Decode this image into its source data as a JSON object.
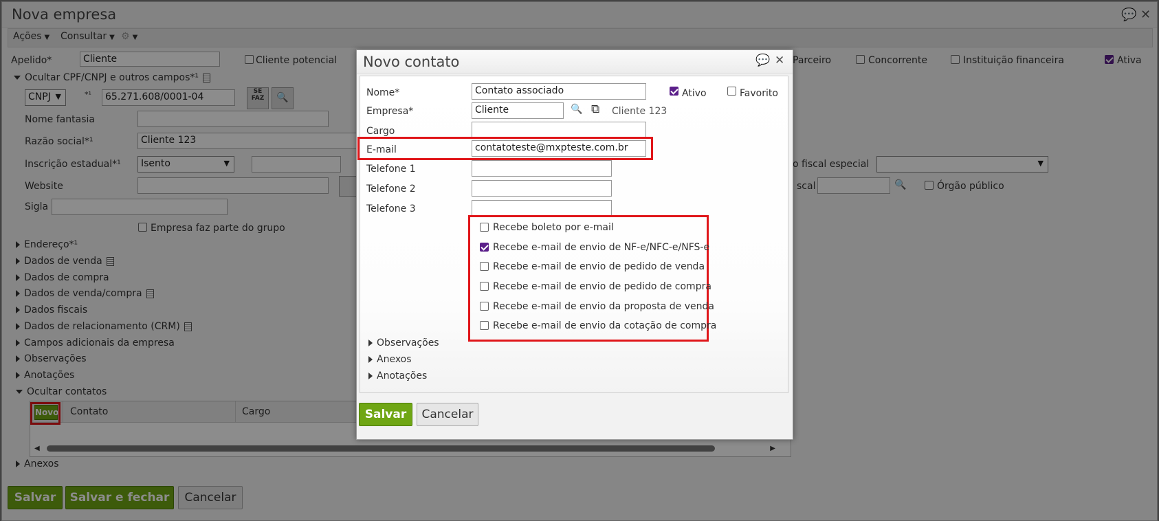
{
  "background": {
    "title": "Nova empresa",
    "toolbar": {
      "acoes": "Ações",
      "consultar": "Consultar"
    },
    "apelido_label": "Apelido*",
    "apelido_value": "Cliente",
    "cliente_potencial": "Cliente potencial",
    "parceiro": "Parceiro",
    "concorrente": "Concorrente",
    "instituicao_financeira": "Instituição financeira",
    "ativa": "Ativa",
    "ocultar_cpf": "Ocultar CPF/CNPJ e outros campos*¹",
    "doc_type": "CNPJ",
    "doc_superscript": "*¹",
    "cnpj_value": "65.271.608/0001-04",
    "nome_fantasia": "Nome fantasia",
    "razao_social": "Razão social*¹",
    "razao_social_value": "Cliente 123",
    "inscricao_estadual": "Inscrição estadual*¹",
    "inscricao_value": "Isento",
    "website": "Website",
    "sigla": "Sigla",
    "empresa_grupo": "Empresa faz parte do grupo",
    "regime_especial": "o fiscal especial",
    "fiscal": "scal",
    "orgao_publico": "Órgão público",
    "sections": [
      "Endereço*¹",
      "Dados de venda",
      "Dados de compra",
      "Dados de venda/compra",
      "Dados fiscais",
      "Dados de relacionamento (CRM)",
      "Campos adicionais da empresa",
      "Observações",
      "Anotações"
    ],
    "ocultar_contatos": "Ocultar contatos",
    "grid": {
      "novo": "Novo",
      "contato": "Contato",
      "cargo": "Cargo"
    },
    "anexos": "Anexos",
    "buttons": {
      "salvar": "Salvar",
      "salvar_fechar": "Salvar e fechar",
      "cancelar": "Cancelar"
    }
  },
  "modal": {
    "title": "Novo contato",
    "nome_label": "Nome*",
    "nome_value": "Contato associado",
    "ativo": "Ativo",
    "favorito": "Favorito",
    "empresa_label": "Empresa*",
    "empresa_value": "Cliente",
    "empresa_link": "Cliente 123",
    "cargo_label": "Cargo",
    "email_label": "E-mail",
    "email_value": "contatoteste@mxpteste.com.br",
    "telefone1": "Telefone 1",
    "telefone2": "Telefone 2",
    "telefone3": "Telefone 3",
    "checkboxes": [
      {
        "label": "Recebe boleto por e-mail",
        "checked": false
      },
      {
        "label": "Recebe e-mail de envio de NF-e/NFC-e/NFS-e",
        "checked": true
      },
      {
        "label": "Recebe e-mail de envio de pedido de venda",
        "checked": false
      },
      {
        "label": "Recebe e-mail de envio de pedido de compra",
        "checked": false
      },
      {
        "label": "Recebe e-mail de envio da proposta de venda",
        "checked": false
      },
      {
        "label": "Recebe e-mail de envio da cotação de compra",
        "checked": false
      }
    ],
    "sections": [
      "Observações",
      "Anexos",
      "Anotações"
    ],
    "salvar": "Salvar",
    "cancelar": "Cancelar"
  },
  "colors": {
    "accent_green": "#6fa614",
    "highlight_red": "#e0161a",
    "checkbox_purple": "#5b1f8a"
  }
}
